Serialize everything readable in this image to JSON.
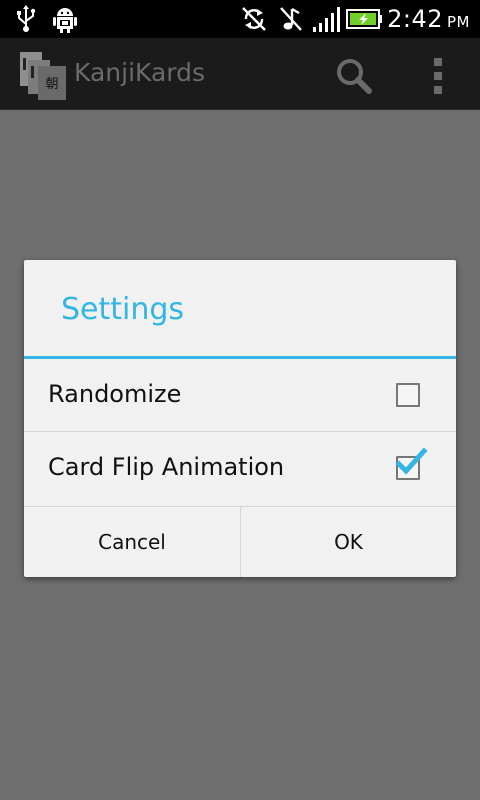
{
  "status_bar": {
    "time": "2:42",
    "ampm": "PM",
    "icons": [
      "usb-icon",
      "android-debug-icon",
      "sync-icon",
      "music-note-icon",
      "signal-icon",
      "battery-charging-icon"
    ]
  },
  "action_bar": {
    "title": "KanjiKards",
    "app_icon_glyph": "朝",
    "icons": [
      "search-icon",
      "overflow-menu-icon"
    ]
  },
  "dialog": {
    "title": "Settings",
    "options": [
      {
        "label": "Randomize",
        "checked": false
      },
      {
        "label": "Card Flip Animation",
        "checked": true
      }
    ],
    "buttons": {
      "cancel": "Cancel",
      "ok": "OK"
    }
  },
  "colors": {
    "accent": "#33b5e5",
    "dim_background": "#6e6e6e",
    "dialog_background": "#f1f1f1"
  }
}
